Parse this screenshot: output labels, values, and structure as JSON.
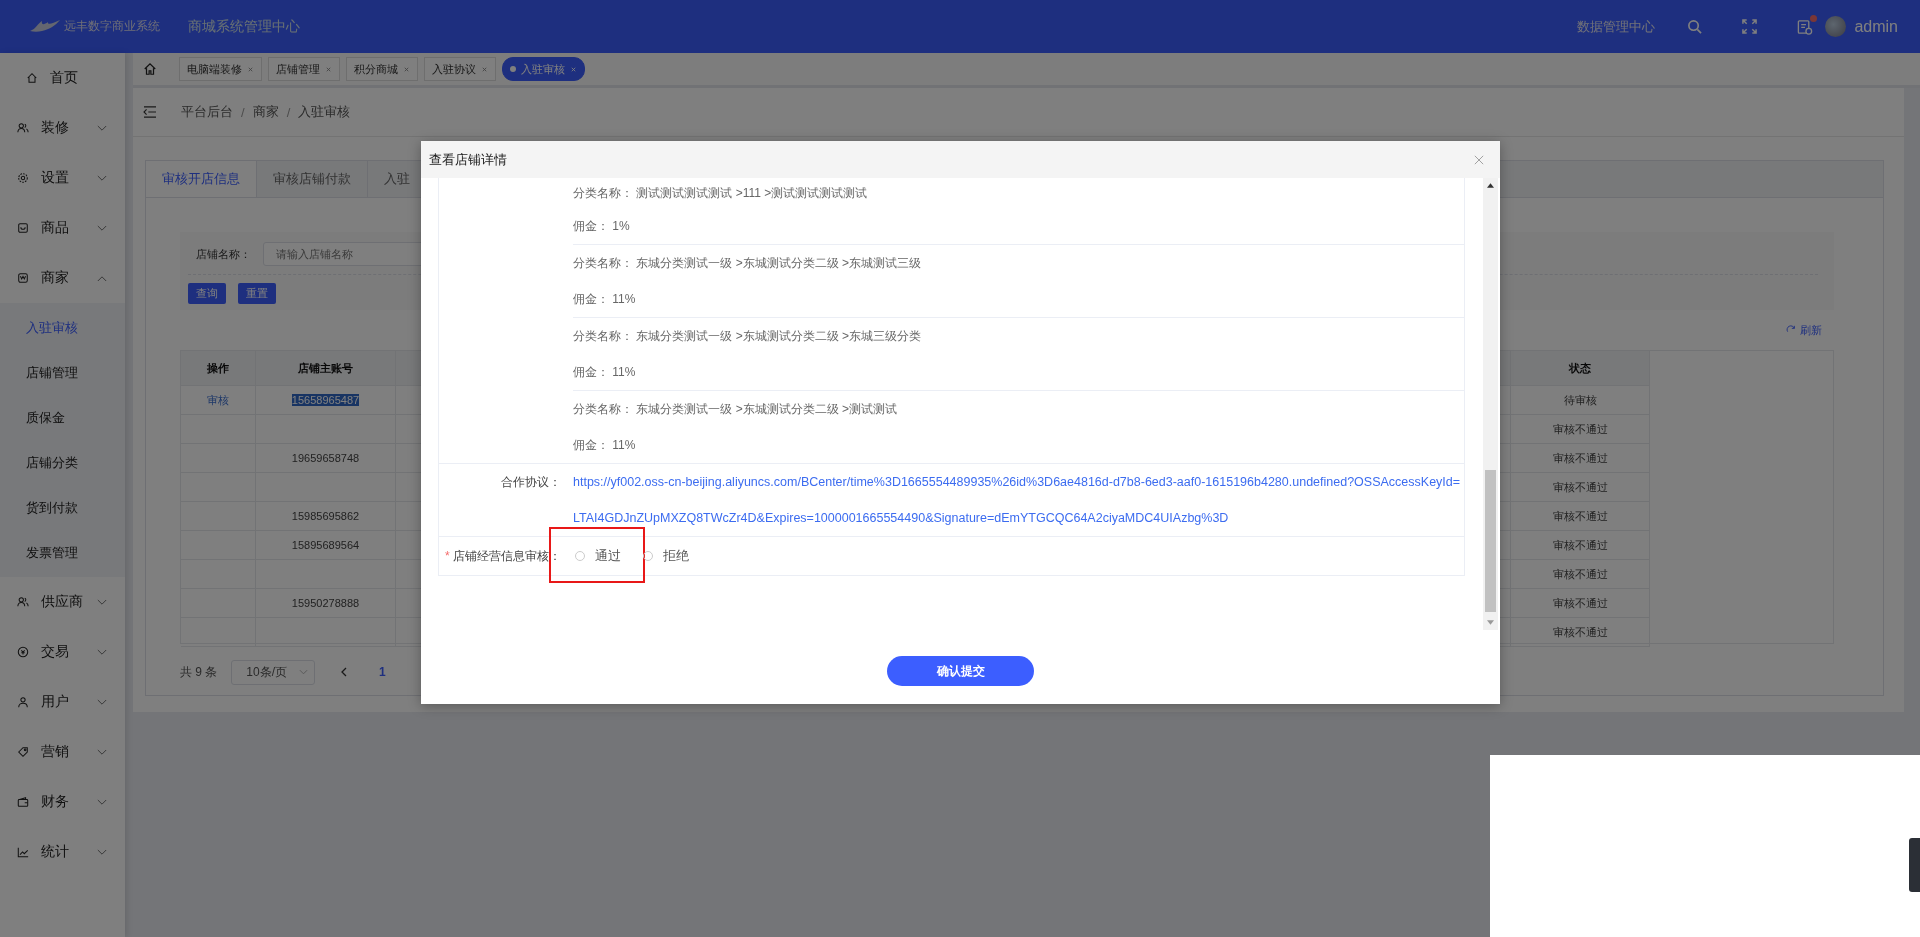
{
  "header": {
    "logo_text": "远丰数字商业系统",
    "system_title": "商城系统管理中心",
    "data_center": "数据管理中心",
    "notification_dot": true,
    "user": "admin"
  },
  "tabs_bar": [
    {
      "label": "电脑端装修",
      "selected": false
    },
    {
      "label": "店铺管理",
      "selected": false
    },
    {
      "label": "积分商城",
      "selected": false
    },
    {
      "label": "入驻协议",
      "selected": false
    },
    {
      "label": "入驻审核",
      "selected": true
    }
  ],
  "sidebar": {
    "items": [
      {
        "kind": "link",
        "label": "首页"
      },
      {
        "kind": "group",
        "label": "装修",
        "expanded": false
      },
      {
        "kind": "group",
        "label": "设置",
        "expanded": false
      },
      {
        "kind": "group",
        "label": "商品",
        "expanded": false
      },
      {
        "kind": "group",
        "label": "商家",
        "expanded": true,
        "children": [
          {
            "label": "入驻审核",
            "selected": true
          },
          {
            "label": "店铺管理",
            "selected": false
          },
          {
            "label": "质保金",
            "selected": false
          },
          {
            "label": "店铺分类",
            "selected": false
          },
          {
            "label": "货到付款",
            "selected": false
          },
          {
            "label": "发票管理",
            "selected": false
          }
        ]
      },
      {
        "kind": "group",
        "label": "供应商",
        "expanded": false
      },
      {
        "kind": "group",
        "label": "交易",
        "expanded": false
      },
      {
        "kind": "group",
        "label": "用户",
        "expanded": false
      },
      {
        "kind": "group",
        "label": "营销",
        "expanded": false
      },
      {
        "kind": "group",
        "label": "财务",
        "expanded": false
      },
      {
        "kind": "group",
        "label": "统计",
        "expanded": false
      }
    ]
  },
  "breadcrumb": [
    {
      "kind": "item",
      "label": "平台后台"
    },
    {
      "kind": "separator",
      "label": "/"
    },
    {
      "kind": "item",
      "label": "商家"
    },
    {
      "kind": "separator",
      "label": "/"
    },
    {
      "kind": "item",
      "label": "入驻审核"
    }
  ],
  "page_tabs": [
    {
      "label": "审核开店信息",
      "selected": true
    },
    {
      "label": "审核店铺付款",
      "selected": false
    },
    {
      "label": "入驻",
      "selected": false
    }
  ],
  "filter": {
    "label": "店铺名称：",
    "placeholder": "请输入店铺名称",
    "buttons": [
      "查询",
      "重置"
    ]
  },
  "refresh": "刷新",
  "table": {
    "columns": [
      "操作",
      "店铺主账号",
      "状态"
    ],
    "rows": [
      {
        "action": "审核",
        "account": "15658965487",
        "account_highlighted": true,
        "status": "待审核"
      },
      {
        "action": "",
        "account": "",
        "status": "审核不通过"
      },
      {
        "action": "",
        "account": "19659658748",
        "account_highlighted": false,
        "status": "审核不通过"
      },
      {
        "action": "",
        "account": "",
        "status": "审核不通过"
      },
      {
        "action": "",
        "account": "15985695862",
        "account_highlighted": false,
        "status": "审核不通过"
      },
      {
        "action": "",
        "account": "15895689564",
        "account_highlighted": false,
        "status": "审核不通过"
      },
      {
        "action": "",
        "account": "",
        "status": "审核不通过"
      },
      {
        "action": "",
        "account": "15950278888",
        "account_highlighted": false,
        "status": "审核不通过"
      },
      {
        "action": "",
        "account": "",
        "status": "审核不通过"
      }
    ]
  },
  "pagination": {
    "total": "共 9 条",
    "page_size": "10条/页",
    "pages": [
      {
        "label": "1",
        "selected": true
      }
    ]
  },
  "modal": {
    "title": "查看店铺详情",
    "categories": [
      {
        "name_label": "分类名称：",
        "path": "测试测试测试测试 >111 >测试测试测试测试",
        "commission_label": "佣金：",
        "commission": "1%"
      },
      {
        "name_label": "分类名称：",
        "path": "东城分类测试一级 >东城测试分类二级 >东城测试三级",
        "commission_label": "佣金：",
        "commission": "11%"
      },
      {
        "name_label": "分类名称：",
        "path": "东城分类测试一级 >东城测试分类二级 >东城三级分类",
        "commission_label": "佣金：",
        "commission": "11%"
      },
      {
        "name_label": "分类名称：",
        "path": "东城分类测试一级 >东城测试分类二级 >测试测试",
        "commission_label": "佣金：",
        "commission": "11%"
      }
    ],
    "agreement": {
      "label": "合作协议：",
      "url": "https://yf002.oss-cn-beijing.aliyuncs.com/BCenter/time%3D1665554489935%26id%3D6ae4816d-d7b8-6ed3-aaf0-1615196b4280.undefined?OSSAccessKeyId=LTAI4GDJnZUpMXZQ8TWcZr4D&Expires=1000001665554490&Signature=dEmYTGCQC64A2ciyaMDC4UIAzbg%3D"
    },
    "review": {
      "required": "*",
      "label": "店铺经营信息审核：",
      "options": [
        {
          "label": "通过",
          "selected": false,
          "annotated": true
        },
        {
          "label": "拒绝",
          "selected": false
        }
      ]
    },
    "submit": "确认提交"
  }
}
